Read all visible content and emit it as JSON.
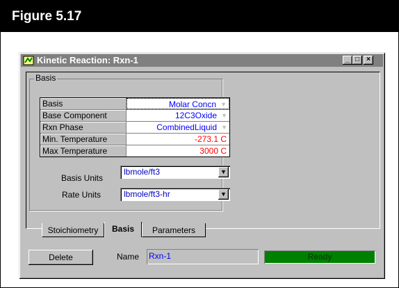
{
  "figure": {
    "title": "Figure 5.17"
  },
  "window": {
    "title": "Kinetic Reaction: Rxn-1",
    "controls": {
      "minimize": "_",
      "maximize": "□",
      "close": "×"
    }
  },
  "basis_group": {
    "label": "Basis",
    "rows": [
      {
        "label": "Basis",
        "value": "Molar Concn"
      },
      {
        "label": "Base Component",
        "value": "12C3Oxide"
      },
      {
        "label": "Rxn Phase",
        "value": "CombinedLiquid"
      },
      {
        "label": "Min. Temperature",
        "value": "-273.1 C"
      },
      {
        "label": "Max Temperature",
        "value": "3000 C"
      }
    ],
    "basis_units": {
      "label": "Basis Units",
      "value": "lbmole/ft3"
    },
    "rate_units": {
      "label": "Rate Units",
      "value": "lbmole/ft3-hr"
    }
  },
  "tabs": [
    {
      "label": "Stoichiometry"
    },
    {
      "label": "Basis"
    },
    {
      "label": "Parameters"
    }
  ],
  "footer": {
    "delete_label": "Delete",
    "name_label": "Name",
    "name_value": "Rxn-1",
    "status": "Ready"
  },
  "colors": {
    "status_green": "#008000",
    "value_blue": "#0000ff",
    "value_red": "#ff0000",
    "window_face": "#c0c0c0"
  }
}
